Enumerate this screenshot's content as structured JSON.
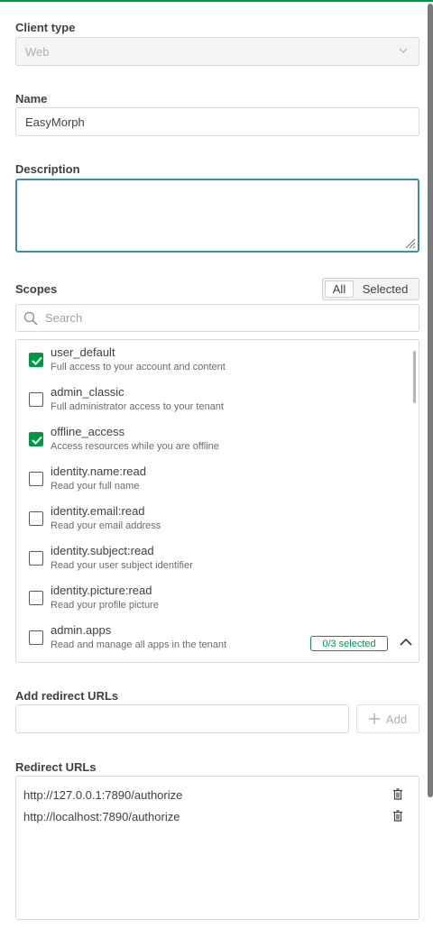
{
  "client_type": {
    "label": "Client type",
    "value": "Web"
  },
  "name": {
    "label": "Name",
    "value": "EasyMorph"
  },
  "description": {
    "label": "Description",
    "value": ""
  },
  "scopes": {
    "label": "Scopes",
    "filter_all": "All",
    "filter_selected": "Selected",
    "search_placeholder": "Search",
    "items": [
      {
        "name": "user_default",
        "desc": "Full access to your account and content",
        "checked": true
      },
      {
        "name": "admin_classic",
        "desc": "Full administrator access to your tenant",
        "checked": false
      },
      {
        "name": "offline_access",
        "desc": "Access resources while you are offline",
        "checked": true
      },
      {
        "name": "identity.name:read",
        "desc": "Read your full name",
        "checked": false
      },
      {
        "name": "identity.email:read",
        "desc": "Read your email address",
        "checked": false
      },
      {
        "name": "identity.subject:read",
        "desc": "Read your user subject identifier",
        "checked": false
      },
      {
        "name": "identity.picture:read",
        "desc": "Read your profile picture",
        "checked": false
      },
      {
        "name": "admin.apps",
        "desc": "Read and manage all apps in the tenant",
        "checked": false,
        "badge": "0/3 selected"
      }
    ]
  },
  "add_redirect": {
    "label": "Add redirect URLs",
    "value": "",
    "button_label": "Add"
  },
  "redirect_urls": {
    "label": "Redirect URLs",
    "items": [
      "http://127.0.0.1:7890/authorize",
      "http://localhost:7890/authorize"
    ]
  },
  "colors": {
    "accent": "#009845",
    "focus": "#3f8ab3"
  }
}
